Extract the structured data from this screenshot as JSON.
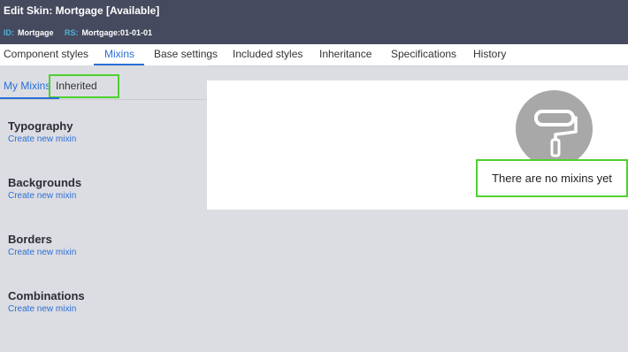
{
  "header": {
    "title": "Edit Skin: Mortgage [Available]",
    "id_label": "ID:",
    "id_value": "Mortgage",
    "rs_label": "RS:",
    "rs_value": "Mortgage:01-01-01"
  },
  "tabs": [
    {
      "label": "Component styles"
    },
    {
      "label": "Mixins"
    },
    {
      "label": "Base settings"
    },
    {
      "label": "Included styles"
    },
    {
      "label": "Inheritance"
    },
    {
      "label": "Specifications"
    },
    {
      "label": "History"
    }
  ],
  "active_tab": "Mixins",
  "subtabs": [
    {
      "label": "My Mixins"
    },
    {
      "label": "Inherited"
    }
  ],
  "sections": [
    {
      "title": "Typography",
      "link": "Create new mixin"
    },
    {
      "title": "Backgrounds",
      "link": "Create new mixin"
    },
    {
      "title": "Borders",
      "link": "Create new mixin"
    },
    {
      "title": "Combinations",
      "link": "Create new mixin"
    }
  ],
  "empty_state": {
    "icon": "paint-roller-icon",
    "message": "There are no mixins yet"
  },
  "colors": {
    "header_bg": "#464a5e",
    "accent": "#2b6fd6",
    "highlight": "#4fd12f",
    "body_bg": "#dcdde2"
  }
}
